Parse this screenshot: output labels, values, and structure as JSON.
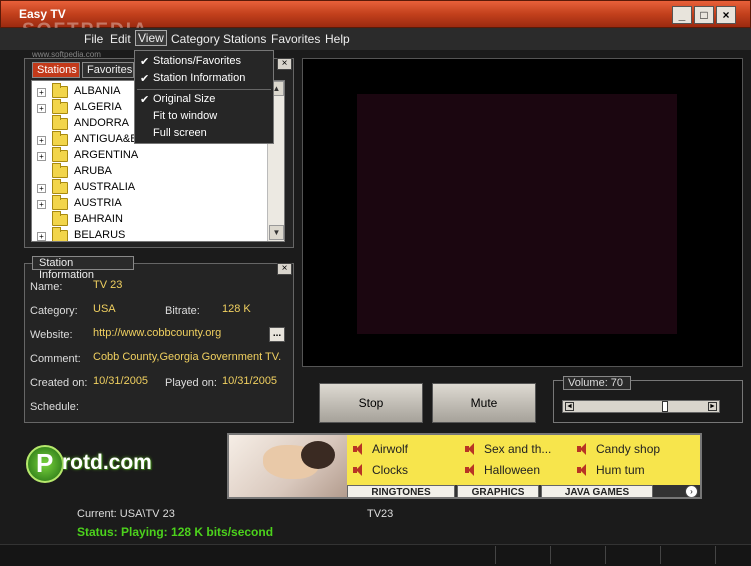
{
  "window": {
    "title": "Easy TV",
    "watermark": "SOFTPEDIA",
    "watermark_url": "www.softpedia.com",
    "controls": [
      "_",
      "□",
      "×"
    ]
  },
  "menubar": {
    "items": [
      "File",
      "Edit",
      "View",
      "Category",
      "Stations",
      "Favorites",
      "Help"
    ]
  },
  "view_menu": {
    "items": [
      {
        "label": "Stations/Favorites",
        "checked": true
      },
      {
        "label": "Station Information",
        "checked": true
      },
      {
        "label": "Original Size",
        "checked": true
      },
      {
        "label": "Fit to window",
        "checked": false
      },
      {
        "label": "Full screen",
        "checked": false
      }
    ],
    "check_glyph": "✔"
  },
  "stations_panel": {
    "tabs": [
      "Stations",
      "Favorites"
    ],
    "close": "×",
    "countries": [
      {
        "name": "ALBANIA",
        "expandable": true
      },
      {
        "name": "ALGERIA",
        "expandable": true
      },
      {
        "name": "ANDORRA",
        "expandable": false
      },
      {
        "name": "ANTIGUA&B",
        "expandable": true
      },
      {
        "name": "ARGENTINA",
        "expandable": true
      },
      {
        "name": "ARUBA",
        "expandable": false
      },
      {
        "name": "AUSTRALIA",
        "expandable": true
      },
      {
        "name": "AUSTRIA",
        "expandable": true
      },
      {
        "name": "BAHRAIN",
        "expandable": false
      },
      {
        "name": "BELARUS",
        "expandable": true
      }
    ],
    "expand_glyph": "+"
  },
  "station_info": {
    "title": "Station Information",
    "close": "×",
    "name_label": "Name:",
    "name": "TV 23",
    "category_label": "Category:",
    "category": "USA",
    "bitrate_label": "Bitrate:",
    "bitrate": "128 K",
    "website_label": "Website:",
    "website": "http://www.cobbcounty.org",
    "website_button": "...",
    "comment_label": "Comment:",
    "comment": "Cobb County,Georgia Government TV.",
    "created_label": "Created on:",
    "created": "10/31/2005",
    "played_label": "Played on:",
    "played": "10/31/2005",
    "schedule_label": "Schedule:"
  },
  "controls": {
    "stop": "Stop",
    "mute": "Mute",
    "volume_label": "Volume: 70",
    "volume": 70
  },
  "logo": {
    "letter": "P",
    "text": "rotd.com"
  },
  "ad": {
    "items": [
      "Airwolf",
      "Sex and th...",
      "Candy shop",
      "Clocks",
      "Halloween",
      "Hum tum"
    ],
    "tabs": [
      "RINGTONES",
      "GRAPHICS",
      "JAVA GAMES"
    ],
    "arrow": "›",
    "speaker_color": "#b83424",
    "background_color": "#f7e54c"
  },
  "status": {
    "current": "Current: USA\\TV 23",
    "station": "TV23",
    "playing": "Status: Playing: 128 K bits/second",
    "playing_color": "#4cd21c"
  }
}
